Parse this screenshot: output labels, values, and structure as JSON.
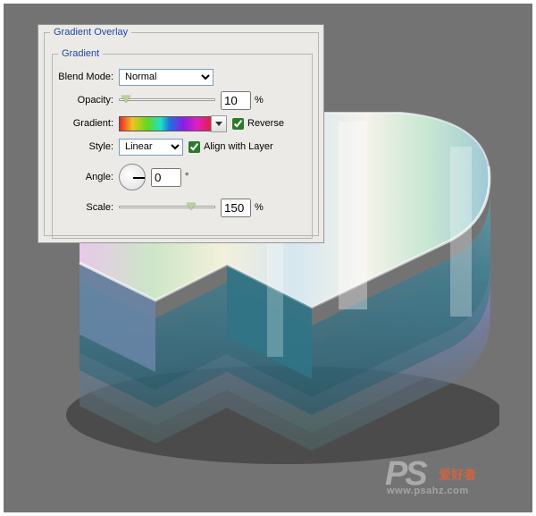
{
  "dialog": {
    "outer_legend": "Gradient Overlay",
    "inner_legend": "Gradient",
    "blend_mode": {
      "label": "Blend Mode:",
      "value": "Normal"
    },
    "opacity": {
      "label": "Opacity:",
      "value": "10",
      "unit": "%",
      "slider_pct": 6
    },
    "gradient": {
      "label": "Gradient:",
      "reverse_label": "Reverse",
      "reverse_checked": true
    },
    "style": {
      "label": "Style:",
      "value": "Linear",
      "align_label": "Align with Layer",
      "align_checked": true
    },
    "angle": {
      "label": "Angle:",
      "value": "0",
      "unit": "°"
    },
    "scale": {
      "label": "Scale:",
      "value": "150",
      "unit": "%",
      "slider_pct": 72
    }
  },
  "watermark": {
    "ps": "PS",
    "cn": "爱好者",
    "url": "www.psahz.com"
  }
}
